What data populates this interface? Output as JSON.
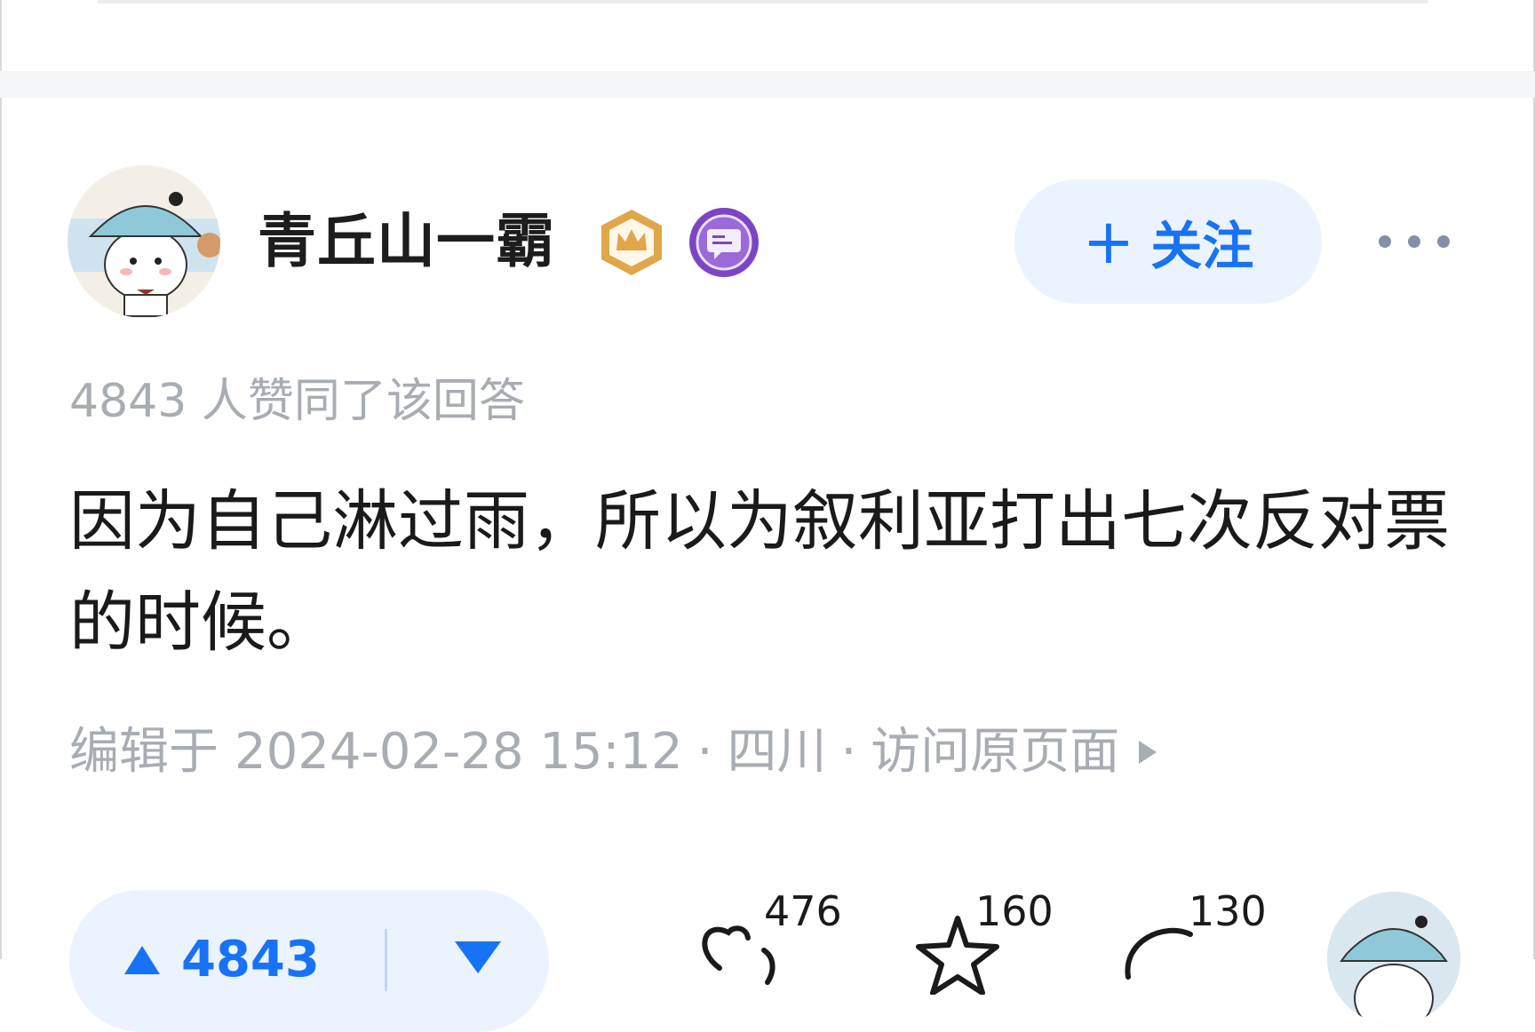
{
  "author": {
    "name": "青丘山一霸",
    "badges": [
      "crown-badge-icon",
      "speech-badge-icon"
    ],
    "follow_label": "关注",
    "avatar_icon": "avatar-cartoon-icon"
  },
  "answer": {
    "vote_summary": "4843 人赞同了该回答",
    "text": "因为自己淋过雨，所以为叙利亚打出七次反对票的时候。",
    "edited_prefix": "编辑于",
    "edited_time": "2024-02-28 15:12",
    "location": "四川",
    "visit_link": "访问原页面"
  },
  "actions": {
    "upvote_count": "4843",
    "like_count": "476",
    "favorite_count": "160",
    "comment_count": "130"
  },
  "colors": {
    "accent": "#1772f6",
    "accent_bg": "#ebf3ff",
    "muted_text": "#a8acb3",
    "crown_badge": "#e0a64a",
    "speech_badge": "#7b45c4"
  }
}
